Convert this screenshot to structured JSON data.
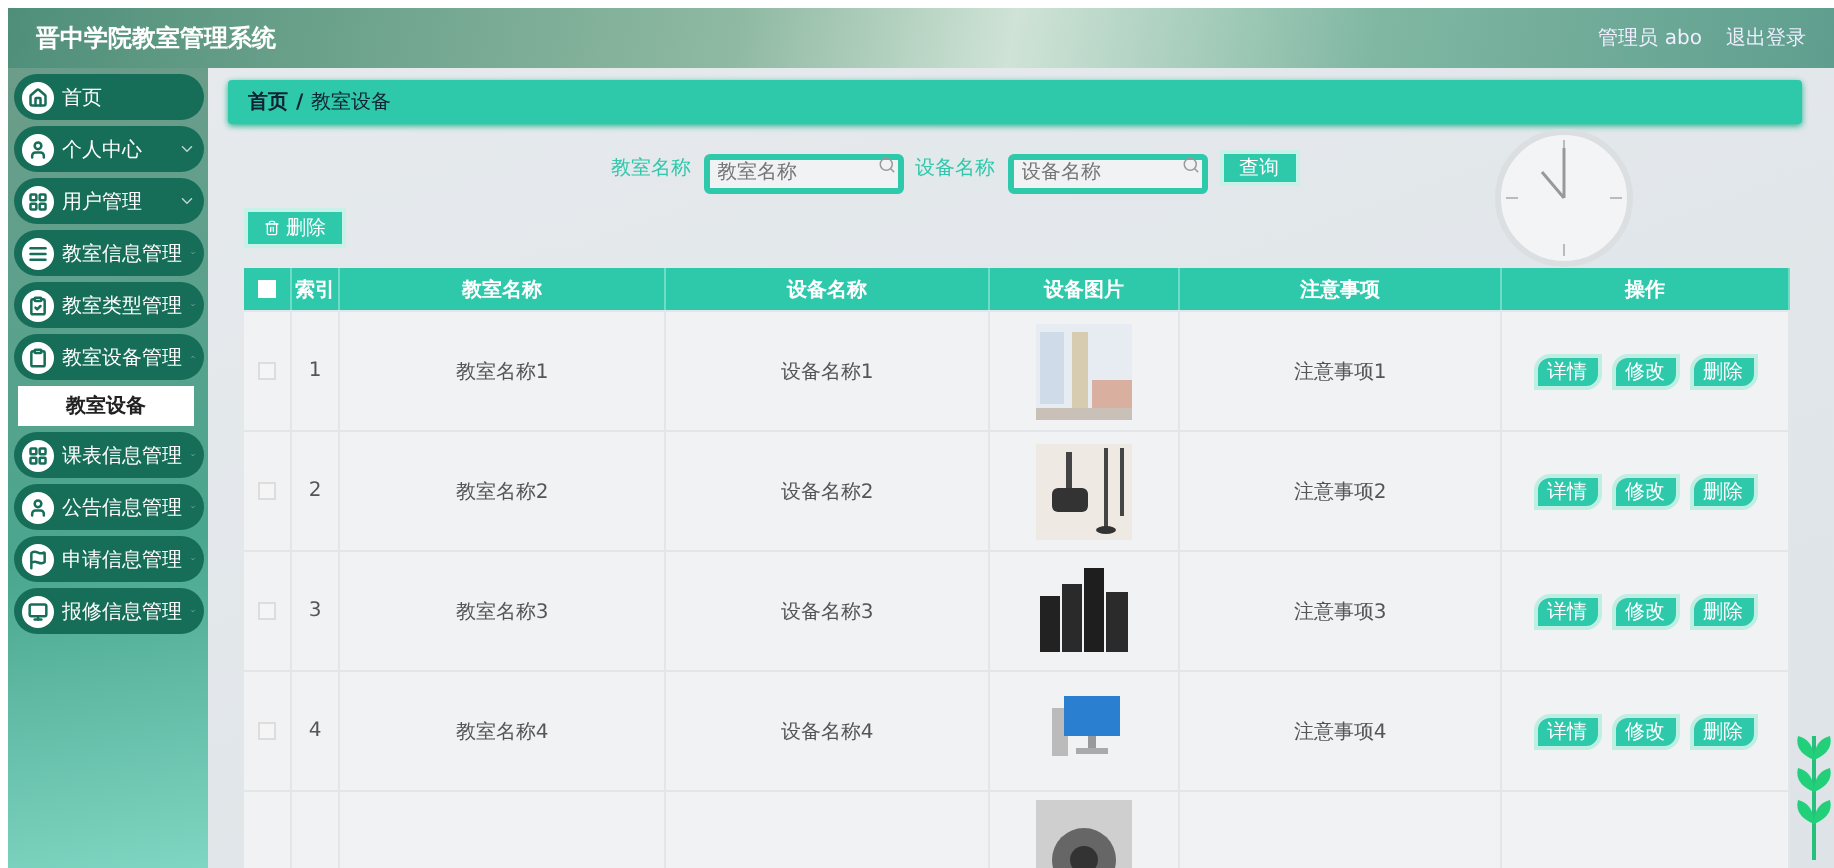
{
  "header": {
    "title": "晋中学院教室管理系统",
    "user": "管理员 abo",
    "logout": "退出登录"
  },
  "sidebar": {
    "items": [
      {
        "label": "首页",
        "kind": "link",
        "selected": false
      },
      {
        "label": "个人中心",
        "kind": "menu",
        "expanded": false
      },
      {
        "label": "用户管理",
        "kind": "menu",
        "expanded": false
      },
      {
        "label": "教室信息管理",
        "kind": "menu",
        "expanded": false
      },
      {
        "label": "教室类型管理",
        "kind": "menu",
        "expanded": false
      },
      {
        "label": "教室设备管理",
        "kind": "menu",
        "expanded": true,
        "children": [
          {
            "label": "教室设备",
            "selected": true
          }
        ]
      },
      {
        "label": "课表信息管理",
        "kind": "menu",
        "expanded": false
      },
      {
        "label": "公告信息管理",
        "kind": "menu",
        "expanded": false
      },
      {
        "label": "申请信息管理",
        "kind": "menu",
        "expanded": false
      },
      {
        "label": "报修信息管理",
        "kind": "menu",
        "expanded": false
      }
    ]
  },
  "breadcrumb": {
    "items": [
      "首页",
      "教室设备"
    ],
    "separator": "/"
  },
  "search": {
    "fields": [
      {
        "label": "教室名称",
        "placeholder": "教室名称"
      },
      {
        "label": "设备名称",
        "placeholder": "设备名称"
      }
    ],
    "button": "查询"
  },
  "delete_button": "删除",
  "table": {
    "select_all_checked": false,
    "columns": [
      "索引",
      "教室名称",
      "设备名称",
      "设备图片",
      "注意事项",
      "操作"
    ],
    "rows": [
      {
        "kind": "full",
        "checked": false,
        "index": "1",
        "room": "教室名称1",
        "device": "设备名称1",
        "note": "注意事项1",
        "actions": [
          "详情",
          "修改",
          "删除"
        ]
      },
      {
        "kind": "full",
        "checked": false,
        "index": "2",
        "room": "教室名称2",
        "device": "设备名称2",
        "note": "注意事项2",
        "actions": [
          "详情",
          "修改",
          "删除"
        ]
      },
      {
        "kind": "full",
        "checked": false,
        "index": "3",
        "room": "教室名称3",
        "device": "设备名称3",
        "note": "注意事项3",
        "actions": [
          "详情",
          "修改",
          "删除"
        ]
      },
      {
        "kind": "full",
        "checked": false,
        "index": "4",
        "room": "教室名称4",
        "device": "设备名称4",
        "note": "注意事项4",
        "actions": [
          "详情",
          "修改",
          "删除"
        ]
      },
      {
        "kind": "partial"
      }
    ]
  }
}
